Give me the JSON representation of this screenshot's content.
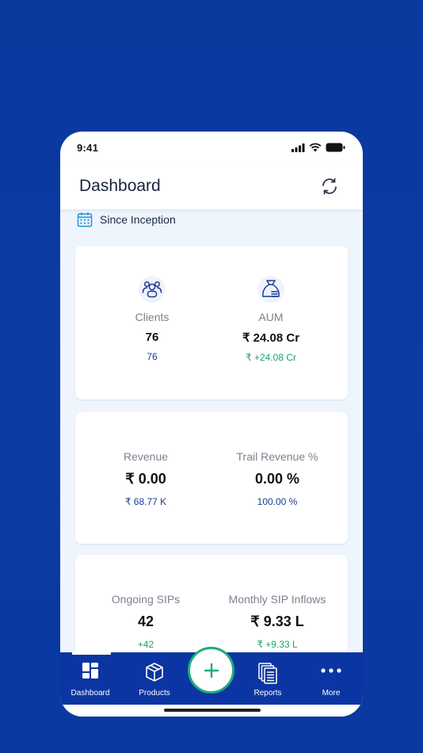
{
  "status_bar": {
    "time": "9:41"
  },
  "header": {
    "title": "Dashboard"
  },
  "filter": {
    "label": "Since Inception"
  },
  "cards": {
    "clients": {
      "label": "Clients",
      "value": "76",
      "sub": "76"
    },
    "aum": {
      "label": "AUM",
      "value": "₹ 24.08 Cr",
      "sub": "₹ +24.08 Cr"
    },
    "revenue": {
      "label": "Revenue",
      "value": "₹ 0.00",
      "sub": "₹ 68.77 K"
    },
    "trail_revenue": {
      "label": "Trail Revenue %",
      "value": "0.00 %",
      "sub": "100.00 %"
    },
    "ongoing_sips": {
      "label": "Ongoing SIPs",
      "value": "42",
      "sub": "+42"
    },
    "monthly_sip_inflows": {
      "label": "Monthly SIP Inflows",
      "value": "₹ 9.33 L",
      "sub": "₹ +9.33 L"
    }
  },
  "bottom_nav": {
    "items": [
      {
        "label": "Dashboard",
        "icon": "dashboard-icon"
      },
      {
        "label": "Products",
        "icon": "box-icon"
      },
      {
        "label": "Reports",
        "icon": "reports-icon"
      },
      {
        "label": "More",
        "icon": "more-icon"
      }
    ],
    "fab_icon": "plus-icon"
  },
  "colors": {
    "background": "#0b3ba3",
    "nav": "#0b35a2",
    "accent_green": "#1aa36a",
    "accent_blue": "#1a3b9a"
  }
}
